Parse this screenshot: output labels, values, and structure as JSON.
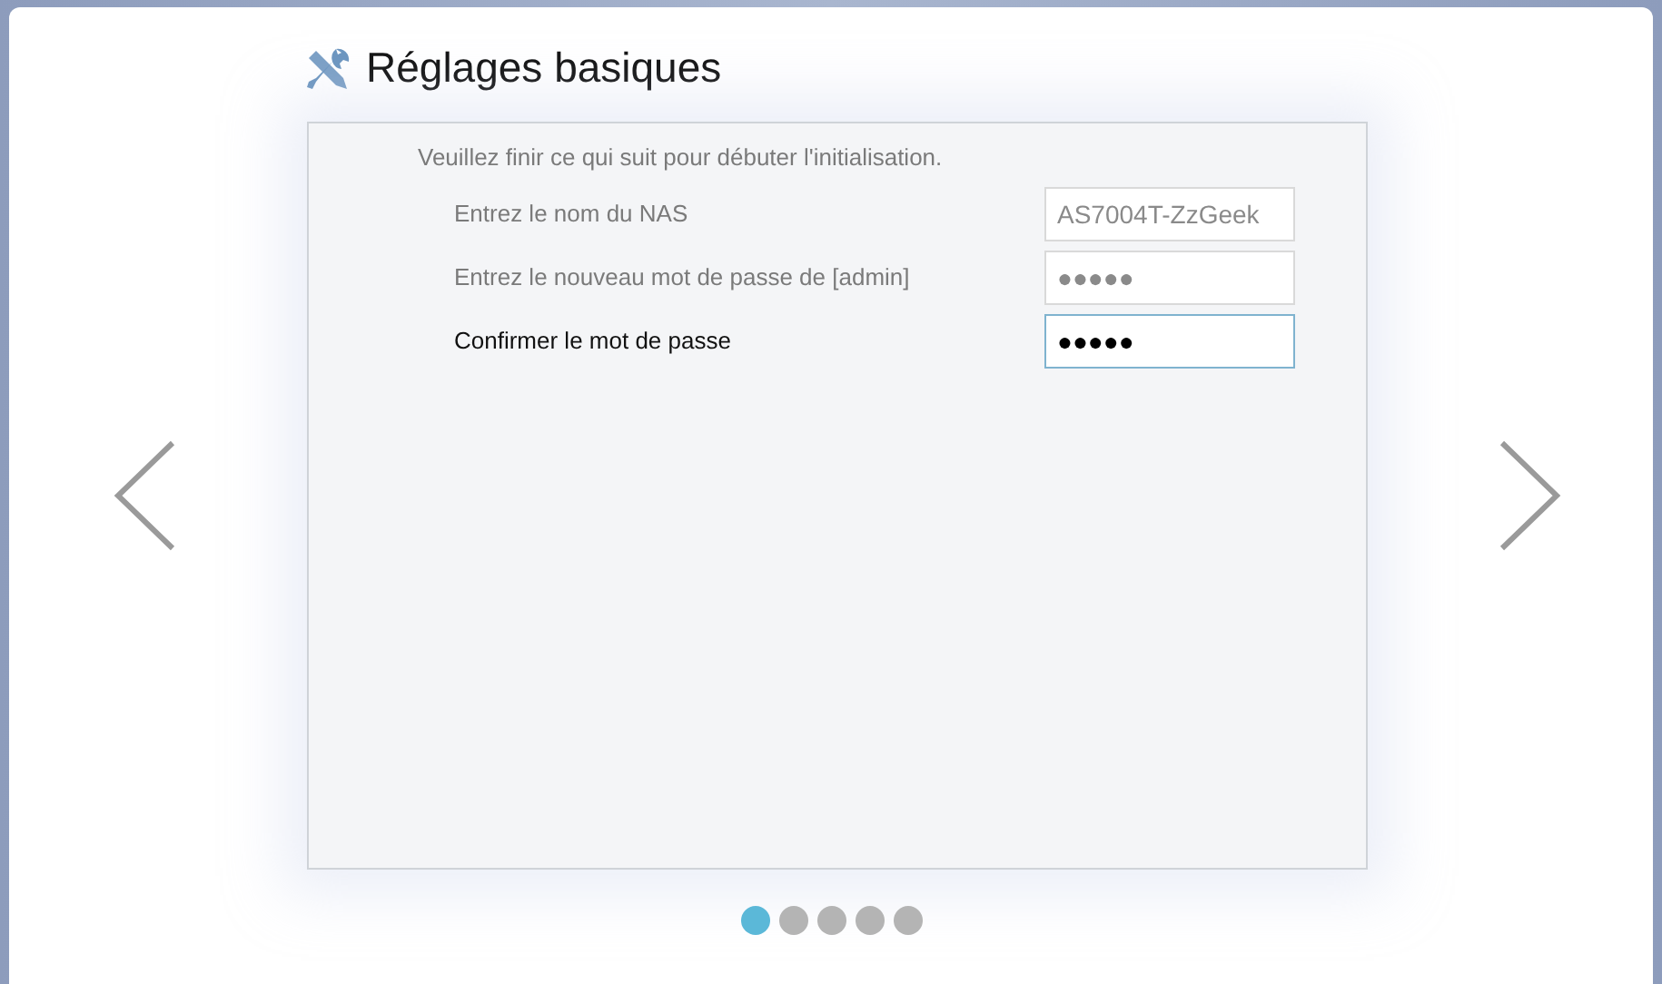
{
  "title": "Réglages basiques",
  "intro": "Veuillez finir ce qui suit pour débuter l'initialisation.",
  "fields": [
    {
      "label": "Entrez le nom du NAS",
      "value": "AS7004T-ZzGeek",
      "focused": false
    },
    {
      "label": "Entrez le nouveau mot de passe de [admin]",
      "value": "●●●●●",
      "focused": false
    },
    {
      "label": "Confirmer le mot de passe",
      "value": "●●●●●",
      "focused": true
    }
  ],
  "pages": [
    {
      "selected": true
    },
    {
      "selected": false
    },
    {
      "selected": false
    },
    {
      "selected": false
    },
    {
      "selected": false
    }
  ]
}
